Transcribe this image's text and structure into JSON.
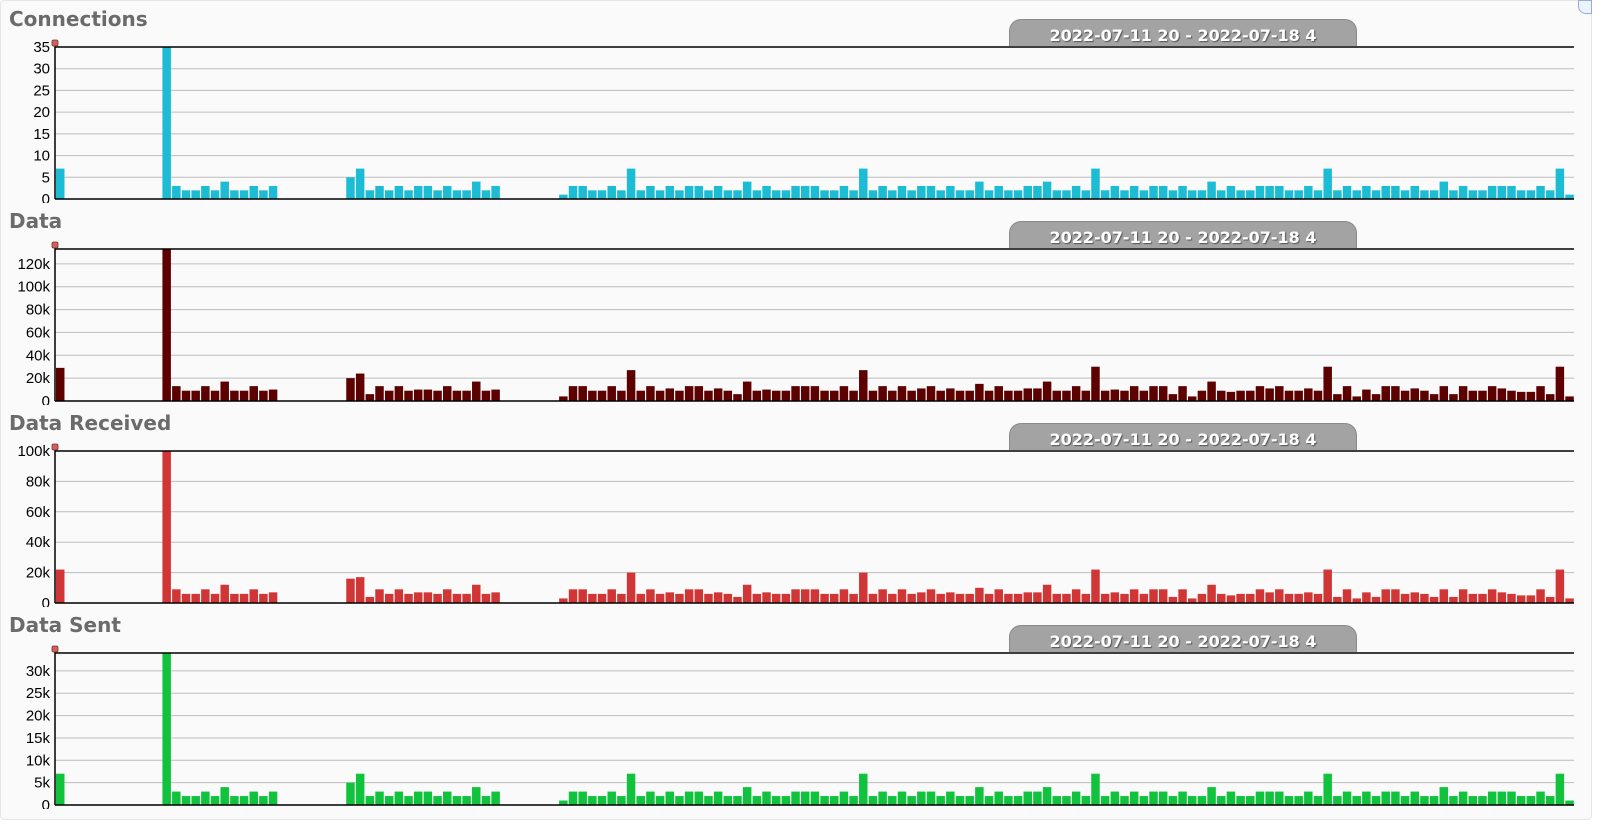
{
  "chart_data": [
    {
      "type": "bar",
      "title": "Connections",
      "range_label": "2022-07-11 20 - 2022-07-18 4",
      "color": "#1cbcd4",
      "ylim": [
        0,
        35
      ],
      "yticks": [
        0,
        5,
        10,
        15,
        20,
        25,
        30,
        35
      ],
      "ytick_labels": [
        "0",
        "5",
        "10",
        "15",
        "20",
        "25",
        "30",
        "35"
      ],
      "grid": true,
      "series": [
        {
          "values": [
            7,
            0,
            0,
            0,
            0,
            0,
            0,
            0,
            0,
            0,
            0,
            35,
            3,
            2,
            2,
            3,
            2,
            4,
            2,
            2,
            3,
            2,
            3,
            0,
            0,
            0,
            0,
            0,
            0,
            0,
            5,
            7,
            2,
            3,
            2,
            3,
            2,
            3,
            3,
            2,
            3,
            2,
            2,
            4,
            2,
            3,
            0,
            0,
            0,
            0,
            0,
            0,
            1,
            3,
            3,
            2,
            2,
            3,
            2,
            7,
            2,
            3,
            2,
            3,
            2,
            3,
            3,
            2,
            3,
            2,
            2,
            4,
            2,
            3,
            2,
            2,
            3,
            3,
            3,
            2,
            2,
            3,
            2,
            7,
            2,
            3,
            2,
            3,
            2,
            3,
            3,
            2,
            3,
            2,
            2,
            4,
            2,
            3,
            2,
            2,
            3,
            3,
            4,
            2,
            2,
            3,
            2,
            7,
            2,
            3,
            2,
            3,
            2,
            3,
            3,
            2,
            3,
            2,
            2,
            4,
            2,
            3,
            2,
            2,
            3,
            3,
            3,
            2,
            2,
            3,
            2,
            7,
            2,
            3,
            2,
            3,
            2,
            3,
            3,
            2,
            3,
            2,
            2,
            4,
            2,
            3,
            2,
            2,
            3,
            3,
            3,
            2,
            2,
            3,
            2,
            7,
            1
          ]
        }
      ]
    },
    {
      "type": "bar",
      "title": "Data",
      "range_label": "2022-07-11 20 - 2022-07-18 4",
      "color": "#5c0000",
      "ylim": [
        0,
        133000
      ],
      "yticks": [
        0,
        20000,
        40000,
        60000,
        80000,
        100000,
        120000
      ],
      "ytick_labels": [
        "0",
        "20k",
        "40k",
        "60k",
        "80k",
        "100k",
        "120k"
      ],
      "grid": true,
      "series": [
        {
          "values": [
            29000,
            0,
            0,
            0,
            0,
            0,
            0,
            0,
            0,
            0,
            0,
            133000,
            13000,
            9000,
            9000,
            13000,
            9000,
            17000,
            9000,
            9000,
            13000,
            9000,
            10000,
            0,
            0,
            0,
            0,
            0,
            0,
            0,
            20000,
            24000,
            6000,
            13000,
            9000,
            13000,
            9000,
            10000,
            10000,
            9000,
            13000,
            9000,
            9000,
            17000,
            9000,
            10000,
            0,
            0,
            0,
            0,
            0,
            0,
            4000,
            13000,
            13000,
            9000,
            9000,
            13000,
            9000,
            27000,
            9000,
            13000,
            9000,
            11000,
            9000,
            13000,
            13000,
            9000,
            11000,
            9000,
            6000,
            17000,
            9000,
            10000,
            9000,
            9000,
            13000,
            13000,
            13000,
            9000,
            9000,
            13000,
            9000,
            27000,
            9000,
            13000,
            9000,
            13000,
            9000,
            11000,
            13000,
            9000,
            11000,
            9000,
            9000,
            15000,
            9000,
            13000,
            9000,
            9000,
            11000,
            11000,
            17000,
            9000,
            9000,
            13000,
            9000,
            30000,
            9000,
            10000,
            9000,
            13000,
            9000,
            13000,
            13000,
            6000,
            13000,
            4000,
            9000,
            17000,
            9000,
            8000,
            9000,
            9000,
            13000,
            11000,
            13000,
            9000,
            9000,
            11000,
            9000,
            30000,
            6000,
            13000,
            4000,
            10000,
            6000,
            13000,
            13000,
            9000,
            11000,
            9000,
            6000,
            13000,
            6000,
            13000,
            9000,
            9000,
            13000,
            11000,
            9000,
            8000,
            8000,
            13000,
            6000,
            30000,
            4000
          ]
        }
      ]
    },
    {
      "type": "bar",
      "title": "Data Received",
      "range_label": "2022-07-11 20 - 2022-07-18 4",
      "color": "#d13636",
      "ylim": [
        0,
        100000
      ],
      "yticks": [
        0,
        20000,
        40000,
        60000,
        80000,
        100000
      ],
      "ytick_labels": [
        "0",
        "20k",
        "40k",
        "60k",
        "80k",
        "100k"
      ],
      "grid": true,
      "series": [
        {
          "values": [
            22000,
            0,
            0,
            0,
            0,
            0,
            0,
            0,
            0,
            0,
            0,
            100000,
            9000,
            6000,
            6000,
            9000,
            6000,
            12000,
            6000,
            6000,
            9000,
            6000,
            7000,
            0,
            0,
            0,
            0,
            0,
            0,
            0,
            16000,
            17000,
            4000,
            9000,
            6000,
            9000,
            6000,
            7000,
            7000,
            6000,
            9000,
            6000,
            6000,
            12000,
            6000,
            7000,
            0,
            0,
            0,
            0,
            0,
            0,
            3000,
            9000,
            9000,
            6000,
            6000,
            9000,
            6000,
            20000,
            6000,
            9000,
            6000,
            7000,
            6000,
            9000,
            9000,
            6000,
            7000,
            6000,
            4000,
            12000,
            6000,
            7000,
            6000,
            6000,
            9000,
            9000,
            9000,
            6000,
            6000,
            9000,
            6000,
            20000,
            6000,
            9000,
            6000,
            9000,
            6000,
            7000,
            9000,
            6000,
            7000,
            6000,
            6000,
            10000,
            6000,
            9000,
            6000,
            6000,
            7000,
            7000,
            12000,
            6000,
            6000,
            9000,
            6000,
            22000,
            6000,
            7000,
            6000,
            9000,
            6000,
            9000,
            9000,
            4000,
            9000,
            3000,
            6000,
            12000,
            6000,
            5000,
            6000,
            6000,
            9000,
            7000,
            9000,
            6000,
            6000,
            7000,
            6000,
            22000,
            4000,
            9000,
            3000,
            7000,
            4000,
            9000,
            9000,
            6000,
            7000,
            6000,
            4000,
            9000,
            4000,
            9000,
            6000,
            6000,
            9000,
            7000,
            6000,
            5000,
            5000,
            9000,
            4000,
            22000,
            3000
          ]
        }
      ]
    },
    {
      "type": "bar",
      "title": "Data Sent",
      "range_label": "2022-07-11 20 - 2022-07-18 4",
      "color": "#10c23c",
      "ylim": [
        0,
        34000
      ],
      "yticks": [
        0,
        5000,
        10000,
        15000,
        20000,
        25000,
        30000
      ],
      "ytick_labels": [
        "0",
        "5k",
        "10k",
        "15k",
        "20k",
        "25k",
        "30k"
      ],
      "grid": true,
      "series": [
        {
          "values": [
            7000,
            0,
            0,
            0,
            0,
            0,
            0,
            0,
            0,
            0,
            0,
            34000,
            3000,
            2000,
            2000,
            3000,
            2000,
            4000,
            2000,
            2000,
            3000,
            2000,
            3000,
            0,
            0,
            0,
            0,
            0,
            0,
            0,
            5000,
            7000,
            2000,
            3000,
            2000,
            3000,
            2000,
            3000,
            3000,
            2000,
            3000,
            2000,
            2000,
            4000,
            2000,
            3000,
            0,
            0,
            0,
            0,
            0,
            0,
            1000,
            3000,
            3000,
            2000,
            2000,
            3000,
            2000,
            7000,
            2000,
            3000,
            2000,
            3000,
            2000,
            3000,
            3000,
            2000,
            3000,
            2000,
            2000,
            4000,
            2000,
            3000,
            2000,
            2000,
            3000,
            3000,
            3000,
            2000,
            2000,
            3000,
            2000,
            7000,
            2000,
            3000,
            2000,
            3000,
            2000,
            3000,
            3000,
            2000,
            3000,
            2000,
            2000,
            4000,
            2000,
            3000,
            2000,
            2000,
            3000,
            3000,
            4000,
            2000,
            2000,
            3000,
            2000,
            7000,
            2000,
            3000,
            2000,
            3000,
            2000,
            3000,
            3000,
            2000,
            3000,
            2000,
            2000,
            4000,
            2000,
            3000,
            2000,
            2000,
            3000,
            3000,
            3000,
            2000,
            2000,
            3000,
            2000,
            7000,
            2000,
            3000,
            2000,
            3000,
            2000,
            3000,
            3000,
            2000,
            3000,
            2000,
            2000,
            4000,
            2000,
            3000,
            2000,
            2000,
            3000,
            3000,
            3000,
            2000,
            2000,
            3000,
            2000,
            7000,
            1000
          ]
        }
      ]
    }
  ]
}
